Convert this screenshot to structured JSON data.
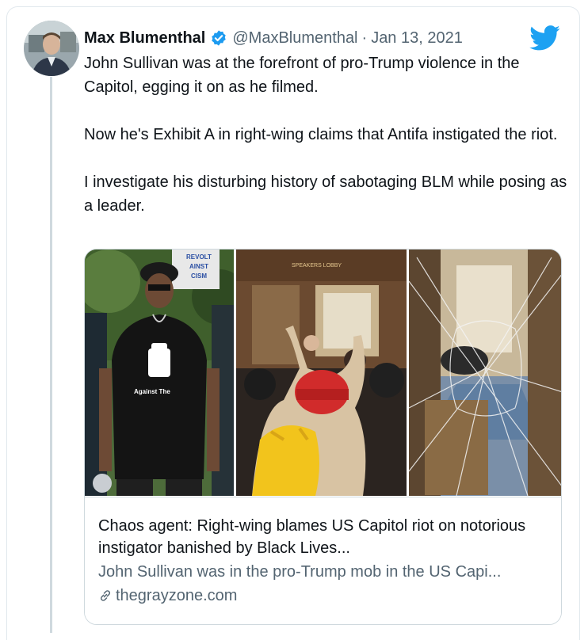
{
  "colors": {
    "accent": "#1da1f2",
    "verified": "#1d9bf0",
    "text": "#0f1419",
    "muted": "#536471",
    "border": "#cfd9de"
  },
  "author": {
    "name": "Max Blumenthal",
    "handle": "@MaxBlumenthal",
    "separator": "·",
    "date": "Jan 13, 2021",
    "verified_icon": "verified-badge-icon",
    "avatar_icon": "avatar-photo"
  },
  "tweet": {
    "paragraphs": [
      "John Sullivan was at the forefront of pro-Trump violence in the Capitol, egging it on as he filmed.",
      "Now he's Exhibit A in right-wing claims that Antifa instigated the riot.",
      "I investigate his disturbing history of sabotaging BLM while posing as a leader."
    ]
  },
  "card": {
    "images": {
      "left_sign_text": "REVOLT\nAINST\nCISM",
      "left_shirt_text": "Against The",
      "middle_sign_text": "SPEAKERS LOBBY"
    },
    "title": "Chaos agent: Right-wing blames US Capitol riot on notorious instigator banished by Black Lives...",
    "description": "John Sullivan was in the pro-Trump mob in the US Capi...",
    "domain": "thegrayzone.com",
    "link_icon": "link-icon"
  },
  "brand_icon": "twitter-bird-icon"
}
